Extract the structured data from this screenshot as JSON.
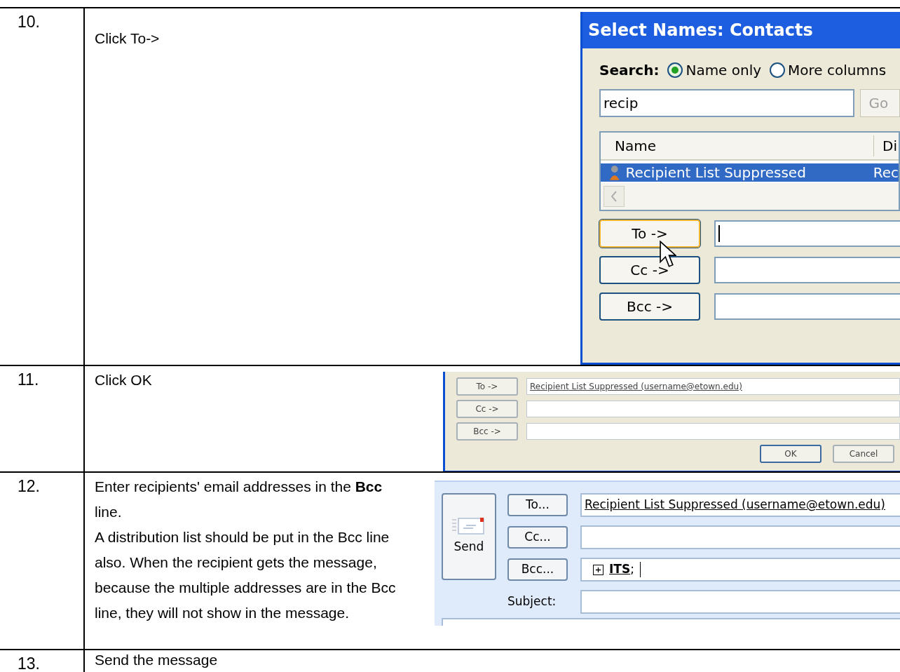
{
  "steps": [
    {
      "number": "10.",
      "paragraphs": [
        "Click To->"
      ],
      "screenshot": {
        "kind": "select_names",
        "title": "Select Names: Contacts",
        "search_label": "Search:",
        "options": [
          {
            "label": "Name only",
            "selected": true
          },
          {
            "label": "More columns",
            "selected": false
          }
        ],
        "query": "recip",
        "go_button": "Go",
        "columns": [
          "Name",
          "Di"
        ],
        "results": [
          {
            "name": "Recipient List Suppressed",
            "column_2": "Rec",
            "selected": true
          }
        ],
        "fields": [
          {
            "button": "To ->",
            "focused": true
          },
          {
            "button": "Cc ->",
            "focused": false
          },
          {
            "button": "Bcc ->",
            "focused": false
          }
        ]
      }
    },
    {
      "number": "11.",
      "paragraphs": [
        "Click OK"
      ],
      "screenshot": {
        "kind": "recipients",
        "fields": [
          {
            "button": "To ->",
            "value": "Recipient List Suppressed (username@etown.edu)"
          },
          {
            "button": "Cc ->"
          },
          {
            "button": "Bcc ->"
          }
        ],
        "actions": [
          "OK",
          "Cancel"
        ]
      }
    },
    {
      "number": "12.",
      "paragraphs": [
        "Enter recipients' email addresses in the **Bcc** line.",
        "A distribution list should be put in the Bcc line also. When the recipient gets the message, because the multiple addresses are in the Bcc line, they will not show in the message."
      ],
      "screenshot": {
        "kind": "message_header",
        "send": "Send",
        "fields": [
          {
            "kind": "address",
            "button": "To...",
            "value": "Recipient List Suppressed (username@etown.edu)"
          },
          {
            "kind": "address",
            "button": "Cc..."
          },
          {
            "kind": "group",
            "button": "Bcc...",
            "value": "ITS",
            "separator": ";"
          }
        ],
        "subject_label": "Subject:"
      }
    },
    {
      "number": "13.",
      "paragraphs": [
        "Send the message"
      ]
    }
  ]
}
